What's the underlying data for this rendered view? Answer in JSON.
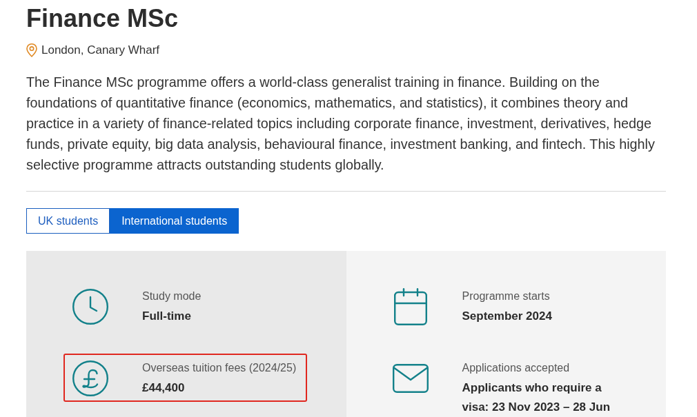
{
  "program": {
    "title": "Finance MSc",
    "location": "London, Canary Wharf",
    "description": "The Finance MSc programme offers a world-class generalist training in finance. Building on the foundations of quantitative finance (economics, mathematics, and statistics), it combines theory and practice in a variety of finance-related topics including corporate finance, investment, derivatives, hedge funds, private equity, big data analysis, behavioural finance, investment banking, and fintech. This highly selective programme attracts outstanding students globally."
  },
  "tabs": [
    {
      "label": "UK students",
      "selected": false
    },
    {
      "label": "International students",
      "selected": true
    }
  ],
  "facts": {
    "columns": [
      {
        "items": [
          {
            "kind": "study_mode",
            "label": "Study mode",
            "value": "Full-time",
            "highlighted": false
          },
          {
            "kind": "fees",
            "label": "Overseas tuition fees (2024/25)",
            "value": "£44,400",
            "highlighted": true
          }
        ]
      },
      {
        "items": [
          {
            "kind": "start",
            "label": "Programme starts",
            "value": "September 2024",
            "highlighted": false
          },
          {
            "kind": "applications",
            "label": "Applications accepted",
            "value": "Applicants who require a visa: 23 Nov 2023 – 28 Jun",
            "highlighted": false
          }
        ]
      }
    ]
  }
}
